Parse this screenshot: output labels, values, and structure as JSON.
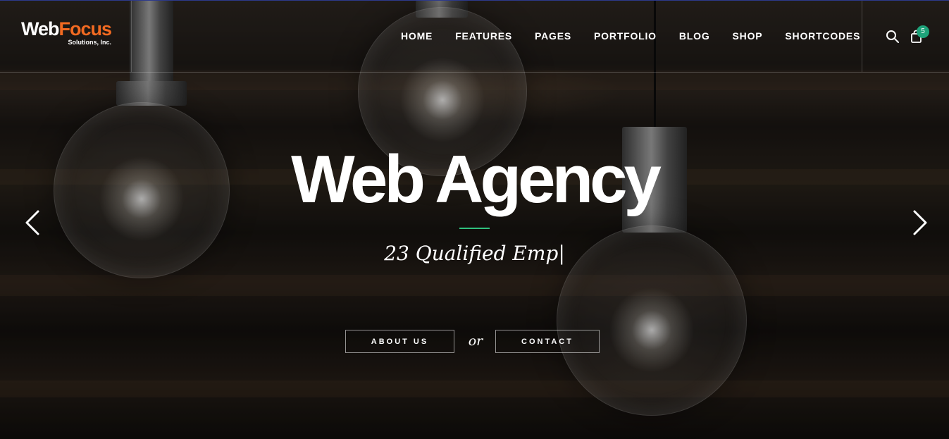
{
  "logo": {
    "main_part1": "Web",
    "main_part2": "Focus",
    "subtitle": "Solutions, Inc."
  },
  "nav": {
    "items": [
      {
        "label": "HOME"
      },
      {
        "label": "FEATURES"
      },
      {
        "label": "PAGES"
      },
      {
        "label": "PORTFOLIO"
      },
      {
        "label": "BLOG"
      },
      {
        "label": "SHOP"
      },
      {
        "label": "SHORTCODES"
      }
    ]
  },
  "header_icons": {
    "search": "search-icon",
    "cart": "shopping-bag-icon",
    "cart_count": "5"
  },
  "hero": {
    "title": "Web Agency",
    "subtitle": "23 Qualified Emp",
    "cursor": "|",
    "button_about": "ABOUT US",
    "or_text": "or",
    "button_contact": "CONTACT"
  },
  "slider": {
    "prev": "chevron-left-icon",
    "next": "chevron-right-icon"
  },
  "colors": {
    "accent_orange": "#f26a21",
    "accent_green": "#2fc07e",
    "badge_green": "#1ea37a"
  }
}
